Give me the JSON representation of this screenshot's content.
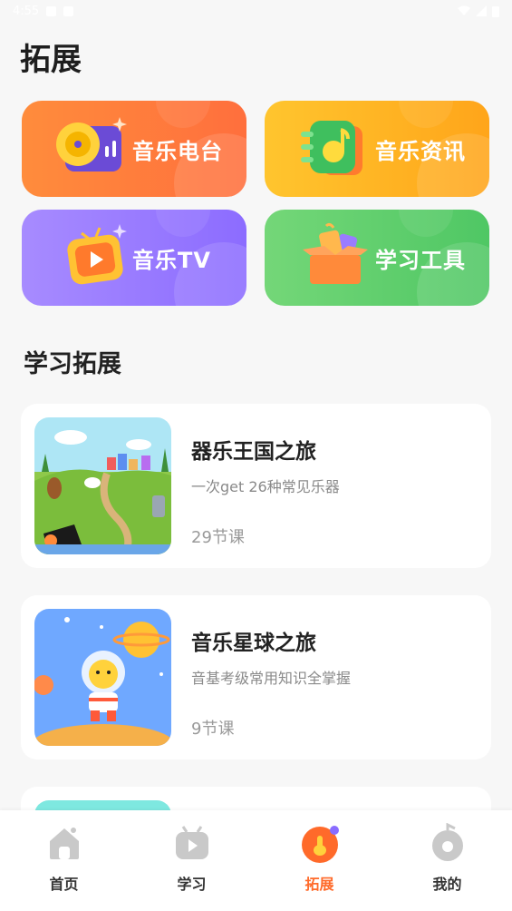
{
  "status_bar": {
    "time": "4:55"
  },
  "page": {
    "title": "拓展"
  },
  "tiles": [
    {
      "label": "音乐电台"
    },
    {
      "label": "音乐资讯"
    },
    {
      "label": "音乐TV"
    },
    {
      "label": "学习工具"
    }
  ],
  "section": {
    "title": "学习拓展"
  },
  "courses": [
    {
      "title": "器乐王国之旅",
      "subtitle": "一次get 26种常见乐器",
      "count": "29节课"
    },
    {
      "title": "音乐星球之旅",
      "subtitle": "音基考级常用知识全掌握",
      "count": "9节课"
    }
  ],
  "tabs": [
    {
      "label": "首页"
    },
    {
      "label": "学习"
    },
    {
      "label": "拓展"
    },
    {
      "label": "我的"
    }
  ],
  "colors": {
    "accent": "#ff6a2a",
    "radio_tile": "#ff7a3c",
    "news_tile": "#ffb71f",
    "tv_tile": "#9b7cff",
    "tools_tile": "#5fcc6b"
  }
}
